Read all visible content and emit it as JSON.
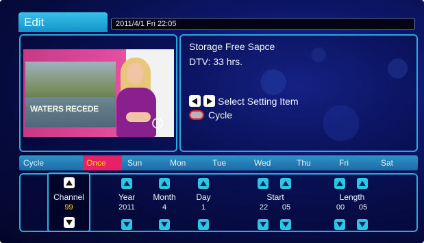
{
  "header": {
    "title": "Edit",
    "datetime": "2011/4/1 Fri 22:05"
  },
  "preview": {
    "caption": "WATERS RECEDE"
  },
  "info": {
    "storage_label": "Storage Free Sapce",
    "dtv_line": "DTV: 33 hrs.",
    "hint_select": "Select Setting Item",
    "hint_cycle": "Cycle"
  },
  "cycle": {
    "label": "Cycle",
    "options": [
      "Once",
      "Sun",
      "Mon",
      "Tue",
      "Wed",
      "Thu",
      "Fri",
      "Sat"
    ],
    "selected": "Once"
  },
  "settings": {
    "channel": {
      "label": "Channel",
      "value": "99"
    },
    "year": {
      "label": "Year",
      "value": "2011"
    },
    "month": {
      "label": "Month",
      "value": "4"
    },
    "day": {
      "label": "Day",
      "value": "1"
    },
    "start": {
      "label": "Start",
      "hour": "22",
      "minute": "05"
    },
    "length": {
      "label": "Length",
      "hour": "00",
      "minute": "05"
    }
  },
  "colors": {
    "accent": "#2fa8dc",
    "selected_bg": "#e8206c",
    "selected_text": "#ffd800",
    "arrow_button": "#2cc7e6"
  },
  "icons": {
    "left_key": "left-arrow-icon",
    "right_key": "right-arrow-icon",
    "red_key": "red-button-icon",
    "up": "up-arrow-icon",
    "down": "down-arrow-icon"
  }
}
